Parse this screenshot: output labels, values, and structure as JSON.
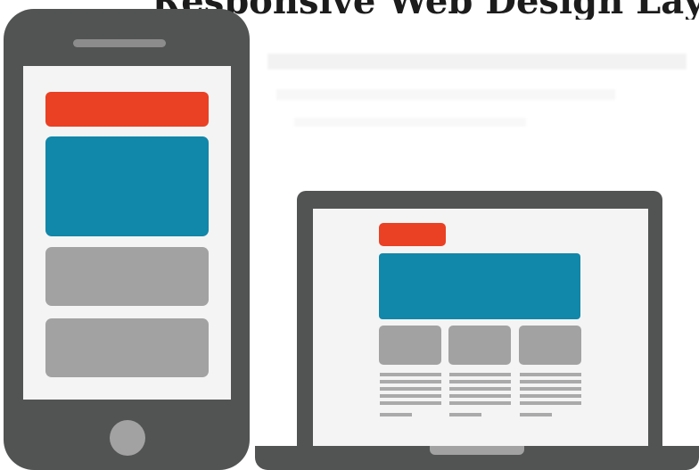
{
  "heading_fragment": "Responsive Web Design Layout Approaches",
  "colors": {
    "device_body": "#525353",
    "screen": "#f4f4f4",
    "header_block": "#ea4024",
    "hero_block": "#1187a9",
    "content_block": "#a2a2a3"
  },
  "phone": {
    "icon": "smartphone-icon",
    "blocks": [
      "header",
      "hero",
      "content",
      "content"
    ]
  },
  "laptop": {
    "icon": "laptop-icon",
    "columns": 3
  }
}
